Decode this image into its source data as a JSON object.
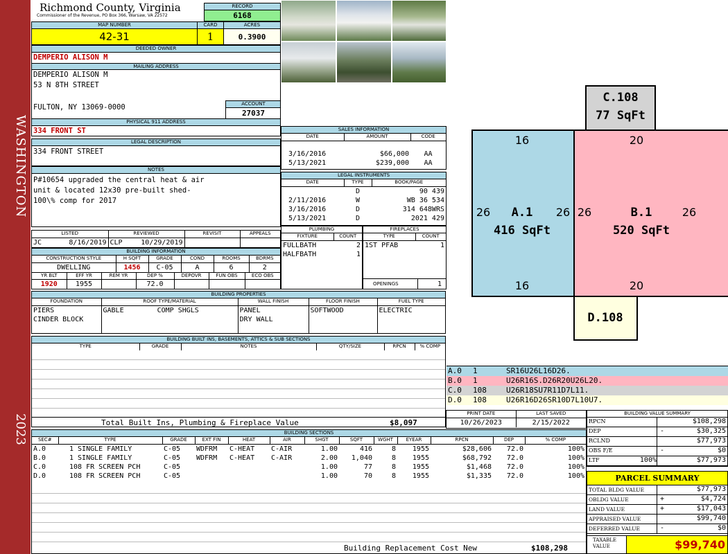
{
  "side_banner": {
    "top": "WASHINGTON",
    "bottom": "2023"
  },
  "header": {
    "county": "Richmond County, Virginia",
    "commissioner": "Commissioner of the Revenue, PO Box 366, Warsaw, VA 22572",
    "record_label": "RECORD",
    "record": "6168"
  },
  "map": {
    "map_label": "MAP NUMBER",
    "map_number": "42-31",
    "card_label": "CARD",
    "card": "1",
    "acres_label": "ACRES",
    "acres": "0.3900"
  },
  "owner": {
    "deeded_label": "DEEDED OWNER",
    "deeded_owner": "DEMPERIO ALISON M",
    "mailing_label": "MAILING ADDRESS",
    "mail_line1": "DEMPERIO ALISON M",
    "mail_line2": "53 N 8TH STREET",
    "mail_line3": "FULTON, NY 13069-0000",
    "account_label": "ACCOUNT",
    "account": "27037"
  },
  "physical": {
    "label": "PHYSICAL 911 ADDRESS",
    "address": "334 FRONT ST"
  },
  "legal": {
    "label": "LEGAL DESCRIPTION",
    "text": "334 FRONT STREET"
  },
  "notes": {
    "label": "NOTES",
    "line1": "P#10654 upgraded the central heat & air",
    "line2": "unit & located 12x30 pre-built shed-",
    "line3": "100\\% comp for 2017"
  },
  "sales": {
    "label": "SALES INFORMATION",
    "headers": [
      "DATE",
      "AMOUNT",
      "CODE"
    ],
    "rows": [
      [
        "3/16/2016",
        "$66,000",
        "AA"
      ],
      [
        "5/13/2021",
        "$239,000",
        "AA"
      ]
    ]
  },
  "legal_instruments": {
    "label": "LEGAL INSTRUMENTS",
    "headers": [
      "DATE",
      "TYPE",
      "BOOK/PAGE"
    ],
    "rows": [
      [
        "",
        "D",
        "90 439"
      ],
      [
        "2/11/2016",
        "W",
        "WB 36 534"
      ],
      [
        "3/16/2016",
        "D",
        "314 648WRS"
      ],
      [
        "5/13/2021",
        "D",
        "2021 429"
      ]
    ]
  },
  "review": {
    "headers": [
      "LISTED",
      "REVIEWED",
      "REVISIT",
      "APPEALS"
    ],
    "listed_by": "JC",
    "listed_date": "8/16/2019",
    "reviewed_by": "CLP",
    "reviewed_date": "10/29/2019"
  },
  "building_info": {
    "label": "BUILDING INFORMATION",
    "headers": [
      "CONSTRUCTION STYLE",
      "H SQFT",
      "GRADE",
      "COND",
      "ROOMS",
      "BDRMS"
    ],
    "values": [
      "DWELLING",
      "1456",
      "C-05",
      "A",
      "6",
      "2"
    ],
    "headers2": [
      "YR BLT",
      "EFF YR",
      "REM YR",
      "DEP %",
      "DEPOVR",
      "FUN OBS",
      "ECO OBS"
    ],
    "values2": [
      "1920",
      "1955",
      "",
      "72.0",
      "",
      "",
      ""
    ]
  },
  "plumbing": {
    "label": "PLUMBING",
    "headers": [
      "FIXTURE",
      "COUNT"
    ],
    "rows": [
      [
        "FULLBATH",
        "2"
      ],
      [
        "HALFBATH",
        "1"
      ]
    ]
  },
  "fireplaces": {
    "label": "FIREPLACES",
    "headers": [
      "TYPE",
      "COUNT"
    ],
    "rows": [
      [
        "1ST PFAB",
        "1"
      ]
    ],
    "openings_label": "OPENINGS",
    "openings": "1"
  },
  "properties": {
    "label": "BUILDING PROPERTIES",
    "headers": [
      "FOUNDATION",
      "ROOF TYPE/MATERIAL",
      "WALL FINISH",
      "FLOOR FINISH",
      "FUEL TYPE"
    ],
    "foundation": [
      "PIERS",
      "CINDER BLOCK"
    ],
    "roof_type": "GABLE",
    "roof_material": "COMP SHGLS",
    "wall": [
      "PANEL",
      "DRY WALL"
    ],
    "floor": "SOFTWOOD",
    "fuel": "ELECTRIC"
  },
  "builtins": {
    "label": "BUILDING BUILT INS, BASEMENTS, ATTICS & SUB SECTIONS",
    "headers": [
      "TYPE",
      "GRADE",
      "NOTES",
      "QTY/SIZE",
      "RPCN",
      "% COMP"
    ],
    "total_label": "Total Built Ins, Plumbing & Fireplace Value",
    "total": "$8,097"
  },
  "sketch": {
    "sections": [
      {
        "id": "C.108",
        "area": "77 SqFt",
        "color": "#d3d3d3"
      },
      {
        "id": "A.1",
        "area": "416 SqFt",
        "color": "#add8e6",
        "top": "16",
        "bottom": "16",
        "left": "26",
        "right": "26"
      },
      {
        "id": "B.1",
        "area": "520 SqFt",
        "color": "#ffb6c1",
        "top": "20",
        "bottom": "20",
        "left": "26",
        "right": "26"
      },
      {
        "id": "D.108",
        "area": "",
        "color": "#ffffe0"
      }
    ],
    "legend": [
      {
        "id": "A.0",
        "num": "1",
        "code": "SR16U26L16D26.",
        "color": "#add8e6"
      },
      {
        "id": "B.0",
        "num": "1",
        "code": "U26R16S.D26R20U26L20.",
        "color": "#ffb6c1"
      },
      {
        "id": "C.0",
        "num": "108",
        "code": "U26R18SU7R11D7L11.",
        "color": "#d3d3d3"
      },
      {
        "id": "D.0",
        "num": "108",
        "code": "U26R16D26SR10D7L10U7.",
        "color": "#ffffe0"
      }
    ]
  },
  "dates": {
    "print_label": "PRINT DATE",
    "print": "10/26/2023",
    "saved_label": "LAST SAVED",
    "saved": "2/15/2022"
  },
  "sections": {
    "label": "BUILDING SECTIONS",
    "headers": [
      "SEC#",
      "TYPE",
      "GRADE",
      "EXT FIN",
      "HEAT",
      "AIR",
      "SHGT",
      "SQFT",
      "WGHT",
      "EYEAR",
      "RPCN",
      "DEP",
      "% COMP"
    ],
    "rows": [
      [
        "A.0",
        "1 SINGLE FAMILY",
        "C-05",
        "WDFRM",
        "C-HEAT",
        "C-AIR",
        "1.00",
        "416",
        "8",
        "1955",
        "$28,606",
        "72.0",
        "100%"
      ],
      [
        "B.0",
        "1 SINGLE FAMILY",
        "C-05",
        "WDFRM",
        "C-HEAT",
        "C-AIR",
        "2.00",
        "1,040",
        "8",
        "1955",
        "$68,792",
        "72.0",
        "100%"
      ],
      [
        "C.0",
        "108 FR SCREEN PCH",
        "C-05",
        "",
        "",
        "",
        "1.00",
        "77",
        "8",
        "1955",
        "$1,468",
        "72.0",
        "100%"
      ],
      [
        "D.0",
        "108 FR SCREEN PCH",
        "C-05",
        "",
        "",
        "",
        "1.00",
        "70",
        "8",
        "1955",
        "$1,335",
        "72.0",
        "100%"
      ]
    ],
    "brcn_label": "Building Replacement Cost New",
    "brcn": "$108,298"
  },
  "value_summary": {
    "label": "BUILDING VALUE SUMMARY",
    "rows": [
      {
        "label": "RPCN",
        "sign": "",
        "pct": "",
        "value": "$108,298"
      },
      {
        "label": "DEP",
        "sign": "-",
        "pct": "",
        "value": "$30,325"
      },
      {
        "label": "RCLND",
        "sign": "",
        "pct": "",
        "value": "$77,973"
      },
      {
        "label": "OBS F/E",
        "sign": "-",
        "pct": "",
        "value": "$0"
      },
      {
        "label": "LTF",
        "sign": "",
        "pct": "100%",
        "value": "$77,973"
      }
    ]
  },
  "parcel": {
    "title": "PARCEL SUMMARY",
    "rows": [
      {
        "label": "TOTAL BLDG VALUE",
        "sign": "",
        "value": "$77,973"
      },
      {
        "label": "OBLDG VALUE",
        "sign": "+",
        "value": "$4,724"
      },
      {
        "label": "LAND VALUE",
        "sign": "+",
        "value": "$17,043"
      },
      {
        "label": "APPRAISED VALUE",
        "sign": "",
        "value": "$99,740"
      },
      {
        "label": "DEFERRED VALUE",
        "sign": "-",
        "value": "$0"
      }
    ],
    "taxable_label": "TAXABLE VALUE",
    "taxable": "$99,740"
  }
}
